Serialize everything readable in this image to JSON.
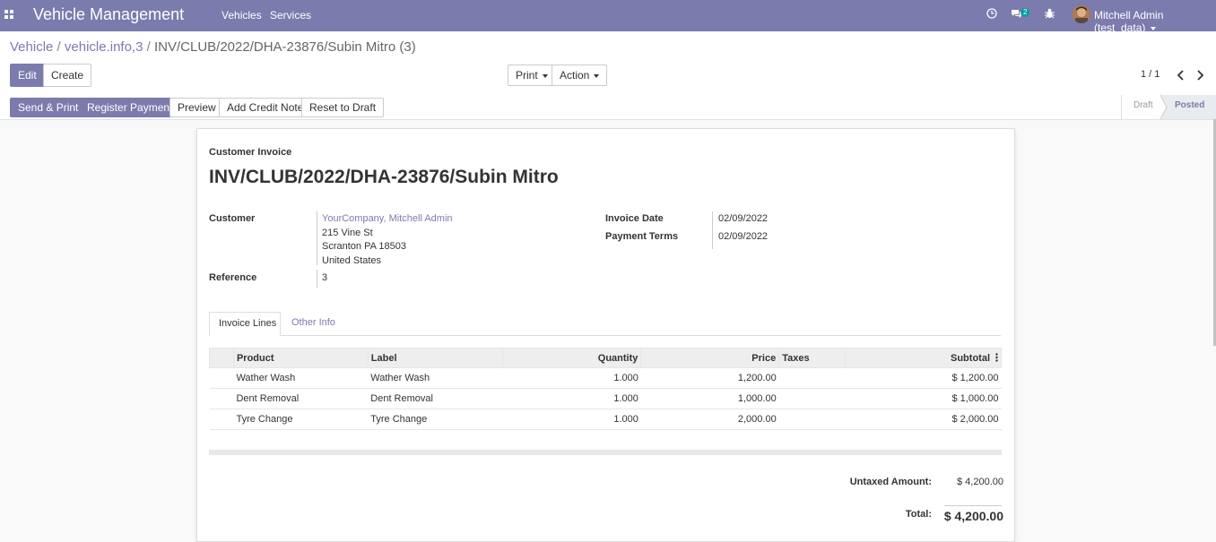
{
  "navbar": {
    "app_title": "Vehicle Management",
    "menu": [
      "Vehicles",
      "Services"
    ],
    "messages_badge": "2",
    "user": "Mitchell Admin (test_data)",
    "icons": [
      "apps-icon",
      "clock-icon",
      "chat-icon",
      "bug-icon"
    ]
  },
  "breadcrumb": {
    "items": [
      "Vehicle",
      "vehicle.info,3"
    ],
    "current": "INV/CLUB/2022/DHA-23876/Subin Mitro (3)",
    "separator": "/"
  },
  "control_panel": {
    "edit": "Edit",
    "create": "Create",
    "print": "Print",
    "action": "Action",
    "pager": "1 / 1"
  },
  "statusbar": {
    "buttons": [
      "Send & Print",
      "Register Payment",
      "Preview",
      "Add Credit Note",
      "Reset to Draft"
    ],
    "stages": [
      "Draft",
      "Posted"
    ],
    "active_stage": "Posted"
  },
  "invoice": {
    "type_label": "Customer Invoice",
    "name": "INV/CLUB/2022/DHA-23876/Subin Mitro",
    "customer_label": "Customer",
    "customer_name": "YourCompany, Mitchell Admin",
    "address": [
      "215 Vine St",
      "Scranton PA 18503",
      "United States"
    ],
    "reference_label": "Reference",
    "reference": "3",
    "invoice_date_label": "Invoice Date",
    "invoice_date": "02/09/2022",
    "payment_terms_label": "Payment Terms",
    "payment_terms": "02/09/2022",
    "tabs": [
      "Invoice Lines",
      "Other Info"
    ],
    "columns": [
      "Product",
      "Label",
      "Quantity",
      "Price",
      "Taxes",
      "Subtotal"
    ],
    "lines": [
      {
        "product": "Wather Wash",
        "label": "Wather Wash",
        "quantity": "1.000",
        "price": "1,200.00",
        "taxes": "",
        "subtotal": "$ 1,200.00"
      },
      {
        "product": "Dent Removal",
        "label": "Dent Removal",
        "quantity": "1.000",
        "price": "1,000.00",
        "taxes": "",
        "subtotal": "$ 1,000.00"
      },
      {
        "product": "Tyre Change",
        "label": "Tyre Change",
        "quantity": "1.000",
        "price": "2,000.00",
        "taxes": "",
        "subtotal": "$ 2,000.00"
      }
    ],
    "untaxed_label": "Untaxed Amount:",
    "untaxed_amount": "$ 4,200.00",
    "total_label": "Total:",
    "total": "$ 4,200.00"
  },
  "colors": {
    "brand": "#7c7bad",
    "badge": "#00a09d",
    "link": "#7c7bad"
  }
}
